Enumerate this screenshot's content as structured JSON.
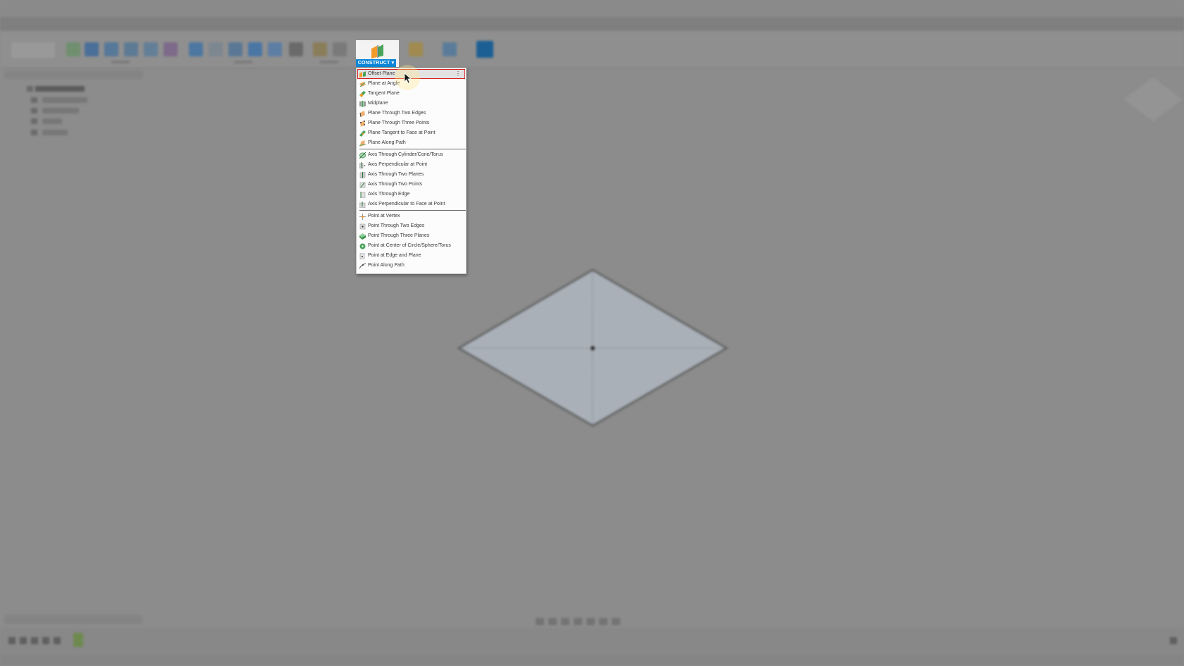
{
  "construct": {
    "label": "CONSTRUCT ▾"
  },
  "menu": {
    "more_glyph": "⋮",
    "items": [
      {
        "label": "Offset Plane",
        "icon": "offset-plane-icon"
      },
      {
        "label": "Plane at Angle",
        "icon": "plane-at-angle-icon"
      },
      {
        "label": "Tangent Plane",
        "icon": "tangent-plane-icon"
      },
      {
        "label": "Midplane",
        "icon": "midplane-icon"
      },
      {
        "label": "Plane Through Two Edges",
        "icon": "plane-two-edges-icon"
      },
      {
        "label": "Plane Through Three Points",
        "icon": "plane-three-points-icon"
      },
      {
        "label": "Plane Tangent to Face at Point",
        "icon": "plane-tangent-face-icon"
      },
      {
        "label": "Plane Along Path",
        "icon": "plane-along-path-icon"
      },
      {
        "label": "Axis Through Cylinder/Cone/Torus",
        "icon": "axis-cylinder-icon"
      },
      {
        "label": "Axis Perpendicular at Point",
        "icon": "axis-perpendicular-icon"
      },
      {
        "label": "Axis Through Two Planes",
        "icon": "axis-two-planes-icon"
      },
      {
        "label": "Axis Through Two Points",
        "icon": "axis-two-points-icon"
      },
      {
        "label": "Axis Through Edge",
        "icon": "axis-edge-icon"
      },
      {
        "label": "Axis Perpendicular to Face at Point",
        "icon": "axis-perp-face-icon"
      },
      {
        "label": "Point at Vertex",
        "icon": "point-vertex-icon"
      },
      {
        "label": "Point Through Two Edges",
        "icon": "point-two-edges-icon"
      },
      {
        "label": "Point Through Three Planes",
        "icon": "point-three-planes-icon"
      },
      {
        "label": "Point at Center of Circle/Sphere/Torus",
        "icon": "point-center-icon"
      },
      {
        "label": "Point at Edge and Plane",
        "icon": "point-edge-plane-icon"
      },
      {
        "label": "Point Along Path",
        "icon": "point-along-path-icon"
      }
    ]
  },
  "colors": {
    "accent": "#0a86d7",
    "highlight_border": "#d31f1f",
    "plane_fill": "#a9b0b8"
  }
}
